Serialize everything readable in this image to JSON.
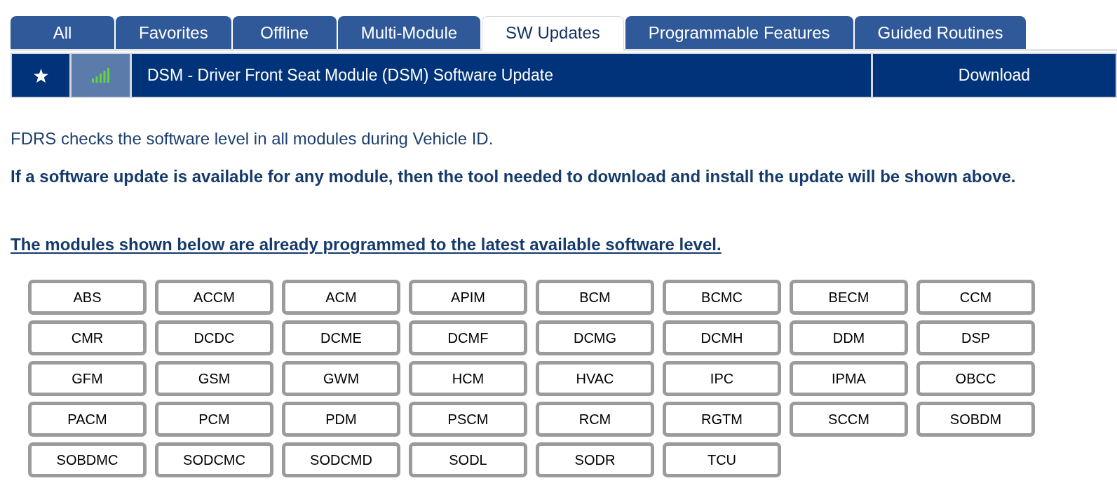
{
  "tabs": [
    {
      "label": "All",
      "selected": false
    },
    {
      "label": "Favorites",
      "selected": false
    },
    {
      "label": "Offline",
      "selected": false
    },
    {
      "label": "Multi-Module",
      "selected": false
    },
    {
      "label": "SW Updates",
      "selected": true
    },
    {
      "label": "Programmable Features",
      "selected": false
    },
    {
      "label": "Guided Routines",
      "selected": false
    }
  ],
  "update": {
    "title": "DSM - Driver Front Seat Module (DSM) Software Update",
    "action": "Download"
  },
  "info": "FDRS checks the software level in all modules during Vehicle ID.",
  "notice": "If a software update is available for any module, then the tool needed to download and install the update will be shown above.",
  "modules_heading": "The modules shown below are already programmed to the latest available software level.",
  "modules": [
    "ABS",
    "ACCM",
    "ACM",
    "APIM",
    "BCM",
    "BCMC",
    "BECM",
    "CCM",
    "CMR",
    "DCDC",
    "DCME",
    "DCMF",
    "DCMG",
    "DCMH",
    "DDM",
    "DSP",
    "GFM",
    "GSM",
    "GWM",
    "HCM",
    "HVAC",
    "IPC",
    "IPMA",
    "OBCC",
    "PACM",
    "PCM",
    "PDM",
    "PSCM",
    "RCM",
    "RGTM",
    "SCCM",
    "SOBDM",
    "SOBDMC",
    "SODCMC",
    "SODCMD",
    "SODL",
    "SODR",
    "TCU"
  ]
}
